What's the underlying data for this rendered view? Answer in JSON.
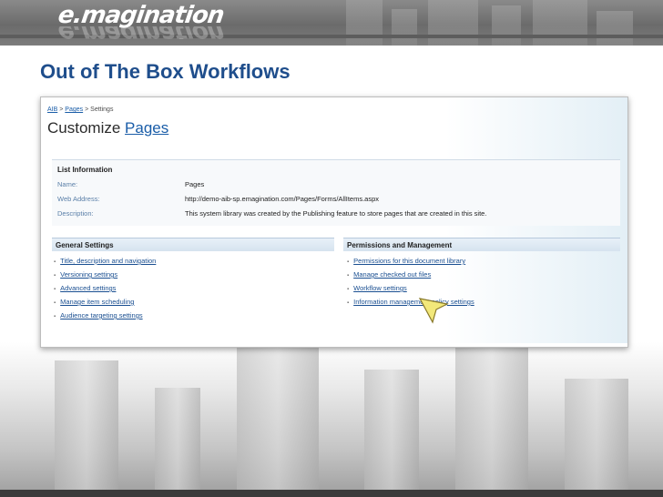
{
  "slide": {
    "logo": "e.magination",
    "title": "Out of The Box Workflows"
  },
  "screenshot": {
    "breadcrumb": [
      {
        "label": "AIB"
      },
      {
        "label": "Pages"
      },
      {
        "label": "Settings"
      }
    ],
    "breadcrumb_separator": ">",
    "page_heading_prefix": "Customize",
    "page_heading_link": "Pages",
    "list_information": {
      "title": "List Information",
      "rows": [
        {
          "label": "Name:",
          "value": "Pages"
        },
        {
          "label": "Web Address:",
          "value": "http://demo-aib-sp.emagination.com/Pages/Forms/AllItems.aspx"
        },
        {
          "label": "Description:",
          "value": "This system library was created by the Publishing feature to store pages that are created in this site."
        }
      ]
    },
    "general_settings": {
      "title": "General Settings",
      "items": [
        "Title, description and navigation",
        "Versioning settings",
        "Advanced settings",
        "Manage item scheduling",
        "Audience targeting settings"
      ]
    },
    "permissions_management": {
      "title": "Permissions and Management",
      "items": [
        "Permissions for this document library",
        "Manage checked out files",
        "Workflow settings",
        "Information management policy settings"
      ]
    }
  },
  "colors": {
    "title": "#1f4e8c",
    "link": "#1a4f91",
    "section_header": "#d6e3ef",
    "cursor": "#f2e87a"
  },
  "icons": [
    "arrow-cursor-icon"
  ]
}
